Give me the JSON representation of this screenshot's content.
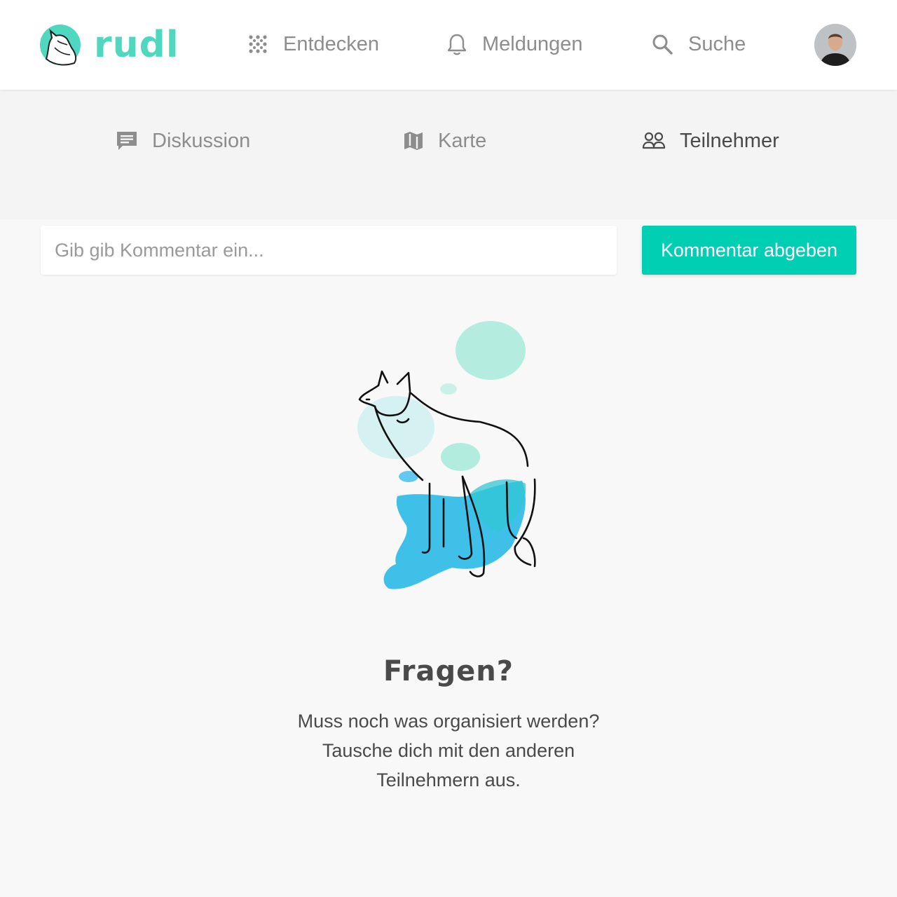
{
  "header": {
    "brand": "rudl",
    "nav": [
      {
        "label": "Entdecken",
        "icon": "dots-grid-icon"
      },
      {
        "label": "Meldungen",
        "icon": "bell-icon"
      },
      {
        "label": "Suche",
        "icon": "search-icon"
      }
    ],
    "avatar": "user-avatar"
  },
  "tabs": [
    {
      "label": "Diskussion",
      "icon": "comment-icon",
      "active": false
    },
    {
      "label": "Karte",
      "icon": "map-icon",
      "active": false
    },
    {
      "label": "Teilnehmer",
      "icon": "people-icon",
      "active": true
    }
  ],
  "comment": {
    "placeholder": "Gib gib Kommentar ein...",
    "submit_label": "Kommentar abgeben"
  },
  "empty_state": {
    "illustration": "wolf-watercolor-illustration",
    "title": "Fragen?",
    "lines": [
      "Muss noch was organisiert werden?",
      "Tausche dich mit den anderen",
      "Teilnehmern aus."
    ]
  },
  "colors": {
    "brand": "#4fd8bf",
    "accent": "#00cfb4",
    "text": "#4a4a4a",
    "muted": "#8d8d8d",
    "background": "#f8f8f8"
  }
}
